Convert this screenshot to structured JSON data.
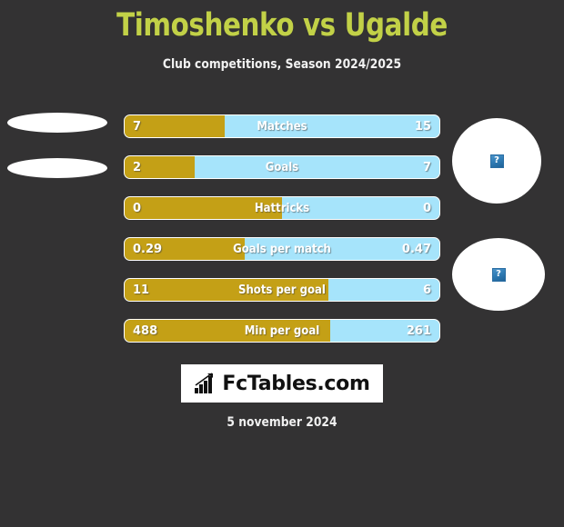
{
  "header": {
    "title": "Timoshenko vs Ugalde",
    "subtitle": "Club competitions, Season 2024/2025",
    "title_color": "#c2d147"
  },
  "colors": {
    "background": "#333233",
    "home_bar": "#c4a016",
    "away_bar": "#a6e4fb",
    "text": "#ffffff"
  },
  "avatars": {
    "left": [
      {
        "name": "home-player-photo-1",
        "state": "broken"
      },
      {
        "name": "home-player-photo-2",
        "state": "broken"
      }
    ],
    "right": [
      {
        "name": "away-player-photo-1",
        "state": "broken",
        "icon": "broken-image-icon",
        "glyph": "?"
      },
      {
        "name": "away-player-photo-2",
        "state": "broken",
        "icon": "broken-image-icon",
        "glyph": "?"
      }
    ]
  },
  "chart_data": {
    "type": "bar",
    "title": "Timoshenko vs Ugalde",
    "subtitle": "Club competitions, Season 2024/2025",
    "orientation": "horizontal-diverging",
    "series": [
      {
        "name": "Timoshenko",
        "side": "left",
        "color": "#c4a016"
      },
      {
        "name": "Ugalde",
        "side": "right",
        "color": "#a6e4fb"
      }
    ],
    "categories": [
      "Matches",
      "Goals",
      "Hattricks",
      "Goals per match",
      "Shots per goal",
      "Min per goal"
    ],
    "rows": [
      {
        "label": "Matches",
        "left": "7",
        "right": "15",
        "left_pct": 31.8
      },
      {
        "label": "Goals",
        "left": "2",
        "right": "7",
        "left_pct": 22.2
      },
      {
        "label": "Hattricks",
        "left": "0",
        "right": "0",
        "left_pct": 50.0
      },
      {
        "label": "Goals per match",
        "left": "0.29",
        "right": "0.47",
        "left_pct": 38.2
      },
      {
        "label": "Shots per goal",
        "left": "11",
        "right": "6",
        "left_pct": 64.7
      },
      {
        "label": "Min per goal",
        "left": "488",
        "right": "261",
        "left_pct": 65.2
      }
    ]
  },
  "logo": {
    "text": "FcTables.com",
    "icon": "bar-chart-arrow-icon"
  },
  "footer": {
    "date": "5 november 2024"
  }
}
